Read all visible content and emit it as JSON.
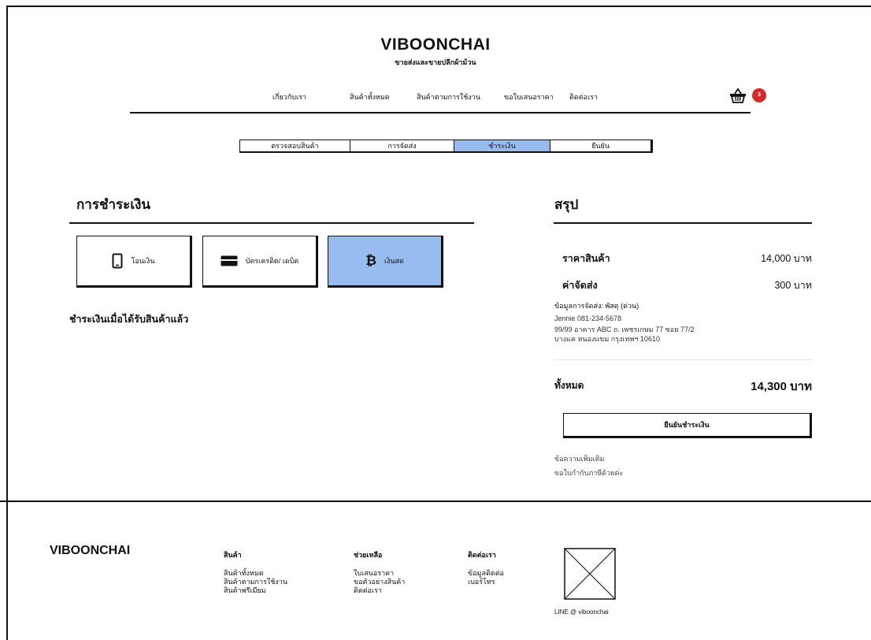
{
  "header": {
    "brand": "VIBOONCHAI",
    "tagline": "ขายส่งและขายปลีกผ้าม้วน",
    "nav": [
      "เกี่ยวกับเรา",
      "สินค้าทั้งหมด",
      "สินค้าตามการใช้งาน",
      "ขอใบเสนอราคา",
      "ติดต่อเรา"
    ],
    "cart_count": "3"
  },
  "stepper": {
    "steps": [
      "ตรวจสอบสินค้า",
      "การจัดส่ง",
      "ชำระเงิน",
      "ยืนยัน"
    ],
    "active_index": 2
  },
  "payment": {
    "title": "การชำระเงิน",
    "methods": [
      {
        "label": "โอนเงิน",
        "icon": "phone-icon"
      },
      {
        "label": "บัตรเครดิต/ เดบิต",
        "icon": "credit-card-icon"
      },
      {
        "label": "เงินสด",
        "icon": "bitcoin-icon"
      }
    ],
    "selected": "เงินสด",
    "note": "ชำระเงินเมื่อได้รับสินค้าแล้ว"
  },
  "summary": {
    "title": "สรุป",
    "product_label": "ราคาสินค้า",
    "product_value": "14,000 บาท",
    "shipping_label": "ค่าจัดส่ง",
    "shipping_value": "300 บาท",
    "shipping_info_title": "ข้อมูลการจัดส่ง: พัสดุ (ด่วน)",
    "shipping_info_lines": [
      "Jennie 081-234-5678",
      "99/99 อาคาร ABC ถ. เพชรเกษม 77 ซอย 77/2",
      "บางแค หนองแขม กรุงเทพฯ 10610"
    ],
    "total_label": "ทั้งหมด",
    "total_value": "14,300 บาท",
    "confirm_button": "ยืนยันชำระเงิน",
    "message_label": "ข้อความเพิ่มเติม",
    "message_value": "ขอใบกำกับภาษีด้วยค่ะ"
  },
  "footer": {
    "brand": "VIBOONCHAI",
    "columns": [
      {
        "title": "สินค้า",
        "links": [
          "สินค้าทั้งหมด",
          "สินค้าตามการใช้งาน",
          "สินค้าพรีเมียม"
        ]
      },
      {
        "title": "ช่วยเหลือ",
        "links": [
          "ใบเสนอราคา",
          "ขอตัวอย่างสินค้า",
          "ติดต่อเรา"
        ]
      },
      {
        "title": "ติดต่อเรา",
        "links": [
          "ข้อมูลติดต่อ",
          "เบอร์โทร"
        ]
      }
    ],
    "line_id": "LINE @ viboonchai"
  }
}
